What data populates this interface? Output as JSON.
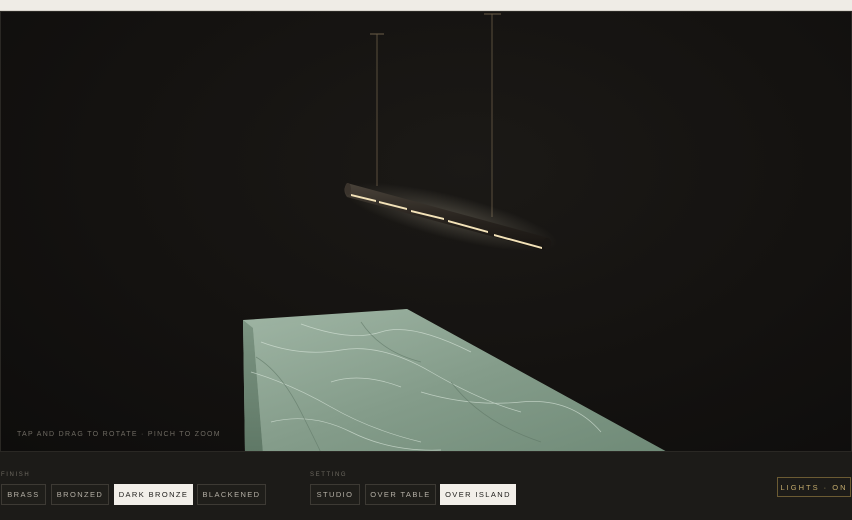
{
  "viewer": {
    "hint": "TAP AND DRAG TO ROTATE · PINCH TO ZOOM"
  },
  "finish": {
    "label": "FINISH",
    "options": [
      "BRASS",
      "BRONZED",
      "DARK BRONZE",
      "BLACKENED"
    ],
    "selected": "DARK BRONZE"
  },
  "setting": {
    "label": "SETTING",
    "options": [
      "STUDIO",
      "OVER TABLE",
      "OVER ISLAND"
    ],
    "selected": "OVER ISLAND"
  },
  "lights": {
    "label": "LIGHTS · ON"
  },
  "colors": {
    "accent": "#c2aa6c",
    "selected_bg": "#f2efe9",
    "fixture": "#2a2622",
    "led_glow": "#f3e2b8",
    "marble": "#8aa493"
  },
  "icons": [
    "pendant-light-fixture",
    "marble-island"
  ]
}
